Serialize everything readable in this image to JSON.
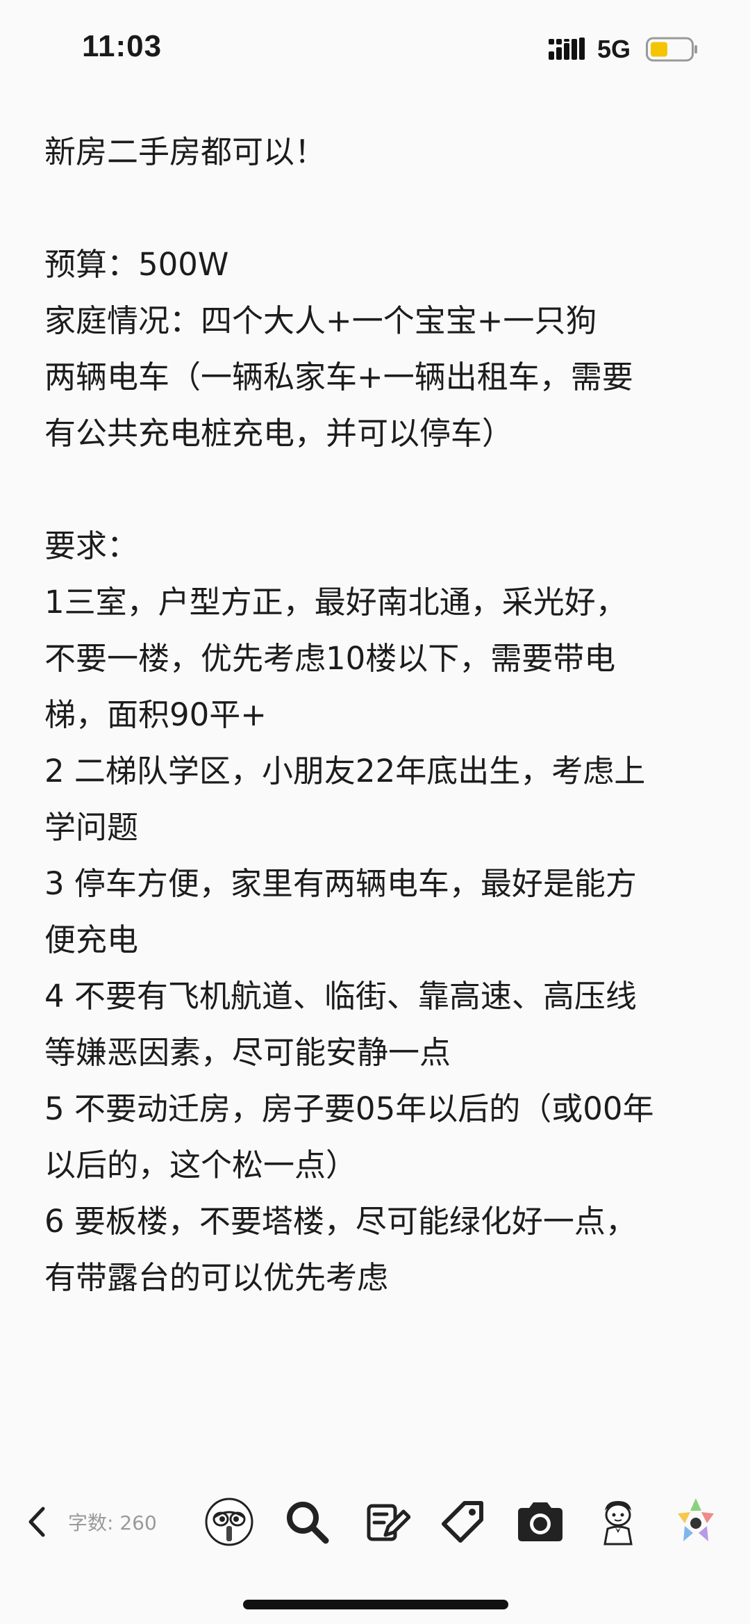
{
  "status_bar": {
    "time": "11:03",
    "network": "5G",
    "battery_color": "#f5c400"
  },
  "note": {
    "lines": [
      "新房二手房都可以！",
      "",
      "预算：500W",
      "家庭情况：四个大人+一个宝宝+一只狗",
      "两辆电车（一辆私家车+一辆出租车，需要",
      "有公共充电桩充电，并可以停车）",
      "",
      "要求：",
      "1三室，户型方正，最好南北通，采光好，",
      "不要一楼，优先考虑10楼以下，需要带电",
      "梯，面积90平+",
      "2 二梯队学区，小朋友22年底出生，考虑上",
      "学问题",
      "3 停车方便，家里有两辆电车，最好是能方",
      "便充电",
      "4 不要有飞机航道、临街、靠高速、高压线",
      "等嫌恶因素，尽可能安静一点",
      "5 不要动迁房，房子要05年以后的（或00年",
      "以后的，这个松一点）",
      "6 要板楼，不要塔楼，尽可能绿化好一点，",
      "有带露台的可以优先考虑"
    ]
  },
  "toolbar": {
    "word_count": "字数: 260",
    "icons": [
      "back-icon",
      "mascot-icon",
      "search-icon",
      "edit-icon",
      "tag-icon",
      "camera-icon",
      "avatar-icon",
      "star-palette-icon"
    ]
  }
}
